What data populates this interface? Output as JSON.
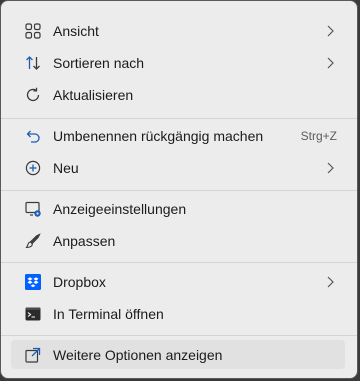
{
  "menu": {
    "items": [
      {
        "label": "Ansicht",
        "icon": "grid-view-icon",
        "submenu": true
      },
      {
        "label": "Sortieren nach",
        "icon": "sort-arrows-icon",
        "submenu": true
      },
      {
        "label": "Aktualisieren",
        "icon": "refresh-icon"
      },
      {
        "label": "Umbenennen rückgängig machen",
        "icon": "undo-icon",
        "shortcut": "Strg+Z"
      },
      {
        "label": "Neu",
        "icon": "plus-circle-icon",
        "submenu": true
      },
      {
        "label": "Anzeigeeinstellungen",
        "icon": "display-settings-icon"
      },
      {
        "label": "Anpassen",
        "icon": "paintbrush-icon"
      },
      {
        "label": "Dropbox",
        "icon": "dropbox-icon",
        "submenu": true
      },
      {
        "label": "In Terminal öffnen",
        "icon": "terminal-icon"
      },
      {
        "label": "Weitere Optionen anzeigen",
        "icon": "more-options-icon",
        "highlighted": true
      }
    ]
  },
  "colors": {
    "menu_background": "#ececec",
    "accent_blue": "#1a5fb4",
    "dropbox_blue": "#0061fe",
    "text": "#1b1b1b",
    "shortcut_text": "#5c5c5c"
  }
}
